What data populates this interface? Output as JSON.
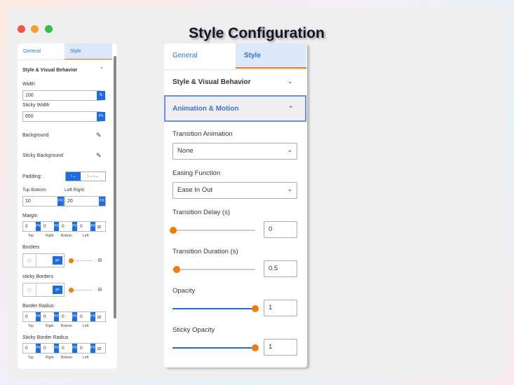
{
  "title": "Style Configuration",
  "colors": {
    "accent": "#1a6ce8",
    "orange": "#f57c00",
    "tab_active_bg": "#dde8fb"
  },
  "left": {
    "tabs": [
      "General",
      "Style"
    ],
    "section": "Style & Visual Behavior",
    "width_label": "Width",
    "width_value": "100",
    "width_unit": "%",
    "sticky_width_label": "Sticky Width",
    "sticky_width_value": "650",
    "px": "PX",
    "background_label": "Background",
    "sticky_background_label": "Sticky Background",
    "padding_label": "Padding:",
    "padding_opt1": "↕↔",
    "padding_opt2": "↑→↓←",
    "top_bottom_label": "Top Bottom:",
    "left_right_label": "Left Right:",
    "top_bottom_value": "10",
    "left_right_value": "20",
    "margin_label": "Margin",
    "borders_label": "Borders",
    "sticky_borders_label": "sticky Borders",
    "border_unit": "px",
    "border_radius_label": "Border Radius",
    "sticky_border_radius_label": "Sticky Border Radius",
    "quad_values": [
      "0",
      "0",
      "0",
      "0"
    ],
    "quad_labels": [
      "Top",
      "Right",
      "Bottom",
      "Left"
    ]
  },
  "right": {
    "tabs": [
      "General",
      "Style"
    ],
    "section1": "Style & Visual Behavior",
    "section2": "Animation & Motion",
    "transition_animation_label": "Transition Animation",
    "transition_animation_value": "None",
    "easing_label": "Easing Function",
    "easing_value": "Ease In Out",
    "delay_label": "Transition Delay (s)",
    "delay_value": "0",
    "duration_label": "Transition Duration (s)",
    "duration_value": "0.5",
    "opacity_label": "Opacity",
    "opacity_value": "1",
    "sticky_opacity_label": "Sticky Opacity",
    "sticky_opacity_value": "1"
  }
}
